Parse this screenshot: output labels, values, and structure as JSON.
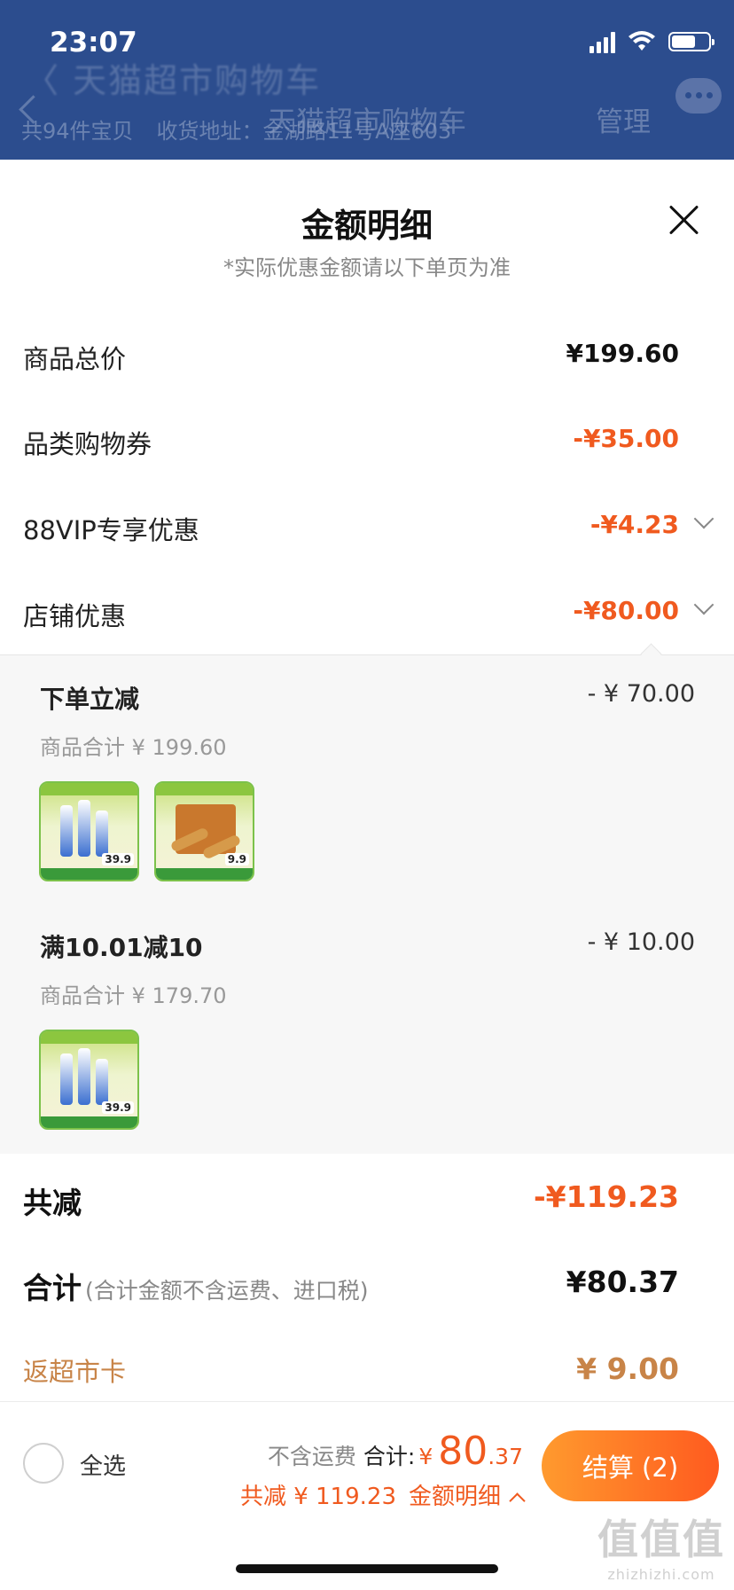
{
  "status_bar": {
    "time": "23:07"
  },
  "background_page": {
    "ghost_title": "〈 天猫超市购物车",
    "nav_title": "天猫超市购物车",
    "manage_label": "管理",
    "item_count": "共94件宝贝",
    "address": "收货地址：金湖路11号A座603"
  },
  "sheet": {
    "title": "金额明细",
    "note": "*实际优惠金额请以下单页为准",
    "rows": [
      {
        "label": "商品总价",
        "value": "¥199.60"
      },
      {
        "label": "品类购物券",
        "value": "-¥35.00"
      },
      {
        "label": "88VIP专享优惠",
        "value": "-¥4.23"
      },
      {
        "label": "店铺优惠",
        "value": "-¥80.00"
      }
    ],
    "discounts": [
      {
        "title": "下单立减",
        "amount": "- ¥ 70.00",
        "subtotal": "商品合计 ¥ 199.60",
        "thumbs": [
          {
            "price": "39.9"
          },
          {
            "price": "9.9"
          }
        ]
      },
      {
        "title": "满10.01减10",
        "amount": "- ¥ 10.00",
        "subtotal": "商品合计 ¥ 179.70",
        "thumbs": [
          {
            "price": "39.9"
          }
        ]
      }
    ],
    "total_saved": {
      "label": "共减",
      "value": "-¥119.23"
    },
    "total": {
      "label": "合计",
      "note": "(合计金额不含运费、进口税)",
      "value": "¥80.37"
    },
    "card_rebate": {
      "label": "返超市卡",
      "value": "¥ 9.00"
    }
  },
  "bottom_bar": {
    "select_all": "全选",
    "no_shipping": "不含运费",
    "sum_label": "合计:",
    "currency": "¥",
    "sum_int": "80",
    "sum_dec": ".37",
    "saved_text": "共减 ¥ 119.23",
    "detail_link": "金额明细",
    "checkout": "结算 (2)"
  },
  "watermark": {
    "logo": "值值值",
    "url": "zhizhizhi.com"
  },
  "colors": {
    "accent_red": "#f05a1f",
    "card_gold": "#c88448",
    "header_blue": "#2c4d8e"
  }
}
